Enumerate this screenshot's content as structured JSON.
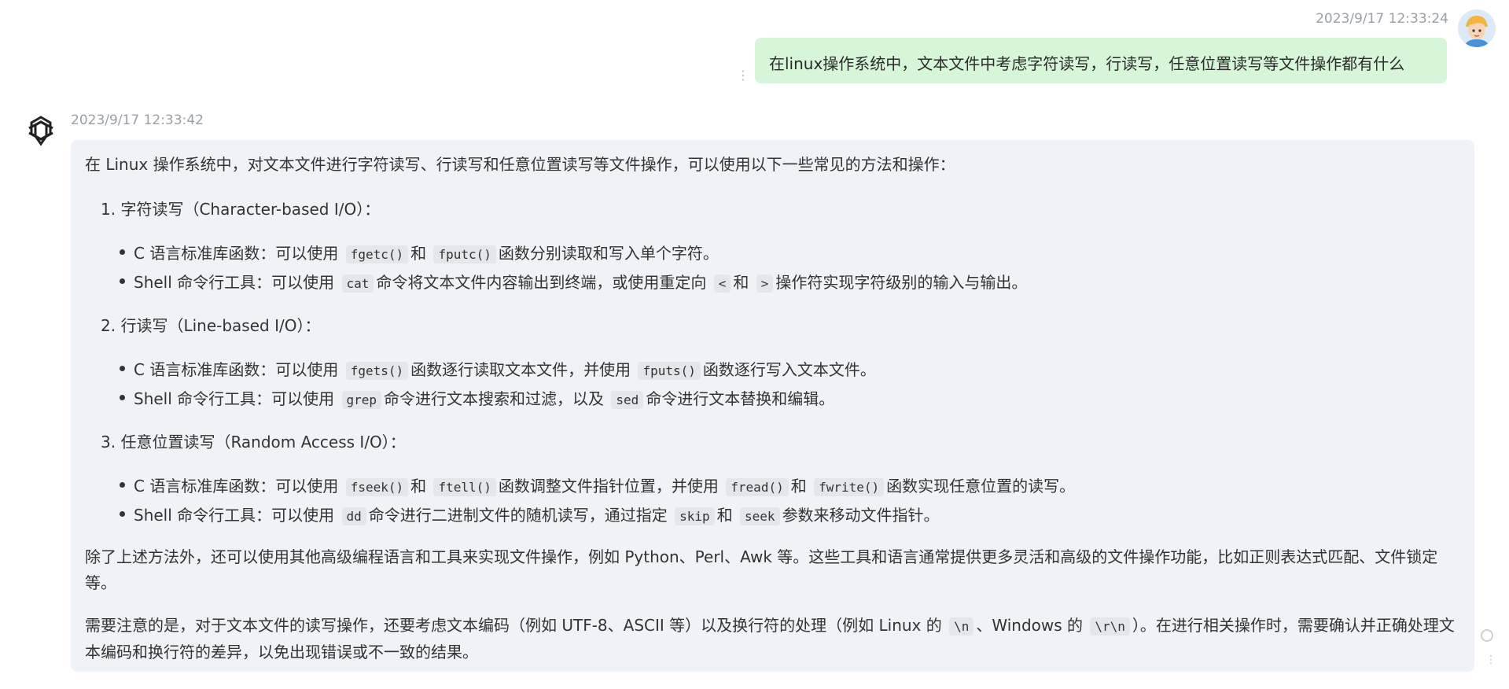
{
  "user_message": {
    "timestamp": "2023/9/17 12:33:24",
    "text": "在linux操作系统中，文本文件中考虑字符读写，行读写，任意位置读写等文件操作都有什么",
    "avatar_icon": "cartoon-user-avatar"
  },
  "assistant_message": {
    "timestamp": "2023/9/17 12:33:42",
    "avatar_icon": "openai-logo-icon",
    "intro": "在 Linux 操作系统中，对文本文件进行字符读写、行读写和任意位置读写等文件操作，可以使用以下一些常见的方法和操作：",
    "sections": [
      {
        "heading": "1. 字符读写（Character-based I/O）：",
        "bullets": [
          {
            "parts": [
              "C 语言标准库函数：可以使用",
              "fgetc()",
              "和",
              "fputc()",
              "函数分别读取和写入单个字符。"
            ]
          },
          {
            "parts": [
              "Shell 命令行工具：可以使用",
              "cat",
              "命令将文本文件内容输出到终端，或使用重定向",
              "<",
              "和",
              ">",
              "操作符实现字符级别的输入与输出。"
            ]
          }
        ]
      },
      {
        "heading": "2. 行读写（Line-based I/O）：",
        "bullets": [
          {
            "parts": [
              "C 语言标准库函数：可以使用",
              "fgets()",
              "函数逐行读取文本文件，并使用",
              "fputs()",
              "函数逐行写入文本文件。"
            ]
          },
          {
            "parts": [
              "Shell 命令行工具：可以使用",
              "grep",
              "命令进行文本搜索和过滤，以及",
              "sed",
              "命令进行文本替换和编辑。"
            ]
          }
        ]
      },
      {
        "heading": "3. 任意位置读写（Random Access I/O）：",
        "bullets": [
          {
            "parts": [
              "C 语言标准库函数：可以使用",
              "fseek()",
              "和",
              "ftell()",
              "函数调整文件指针位置，并使用",
              "fread()",
              "和",
              "fwrite()",
              "函数实现任意位置的读写。"
            ]
          },
          {
            "parts": [
              "Shell 命令行工具：可以使用",
              "dd",
              "命令进行二进制文件的随机读写，通过指定",
              "skip",
              "和",
              "seek",
              "参数来移动文件指针。"
            ]
          }
        ]
      }
    ],
    "para1": "除了上述方法外，还可以使用其他高级编程语言和工具来实现文件操作，例如 Python、Perl、Awk 等。这些工具和语言通常提供更多灵活和高级的文件操作功能，比如正则表达式匹配、文件锁定等。",
    "para2": {
      "parts": [
        "需要注意的是，对于文本文件的读写操作，还要考虑文本编码（例如 UTF-8、ASCII 等）以及换行符的处理（例如 Linux 的",
        "\\n",
        "、Windows 的",
        "\\r\\n",
        "）。在进行相关操作时，需要确认并正确处理文本编码和换行符的差异，以免出现错误或不一致的结果。"
      ]
    }
  },
  "colors": {
    "user_bubble": "#d6f5d9",
    "assistant_bubble": "#eff2f6",
    "timestamp": "#9aa0a6"
  }
}
